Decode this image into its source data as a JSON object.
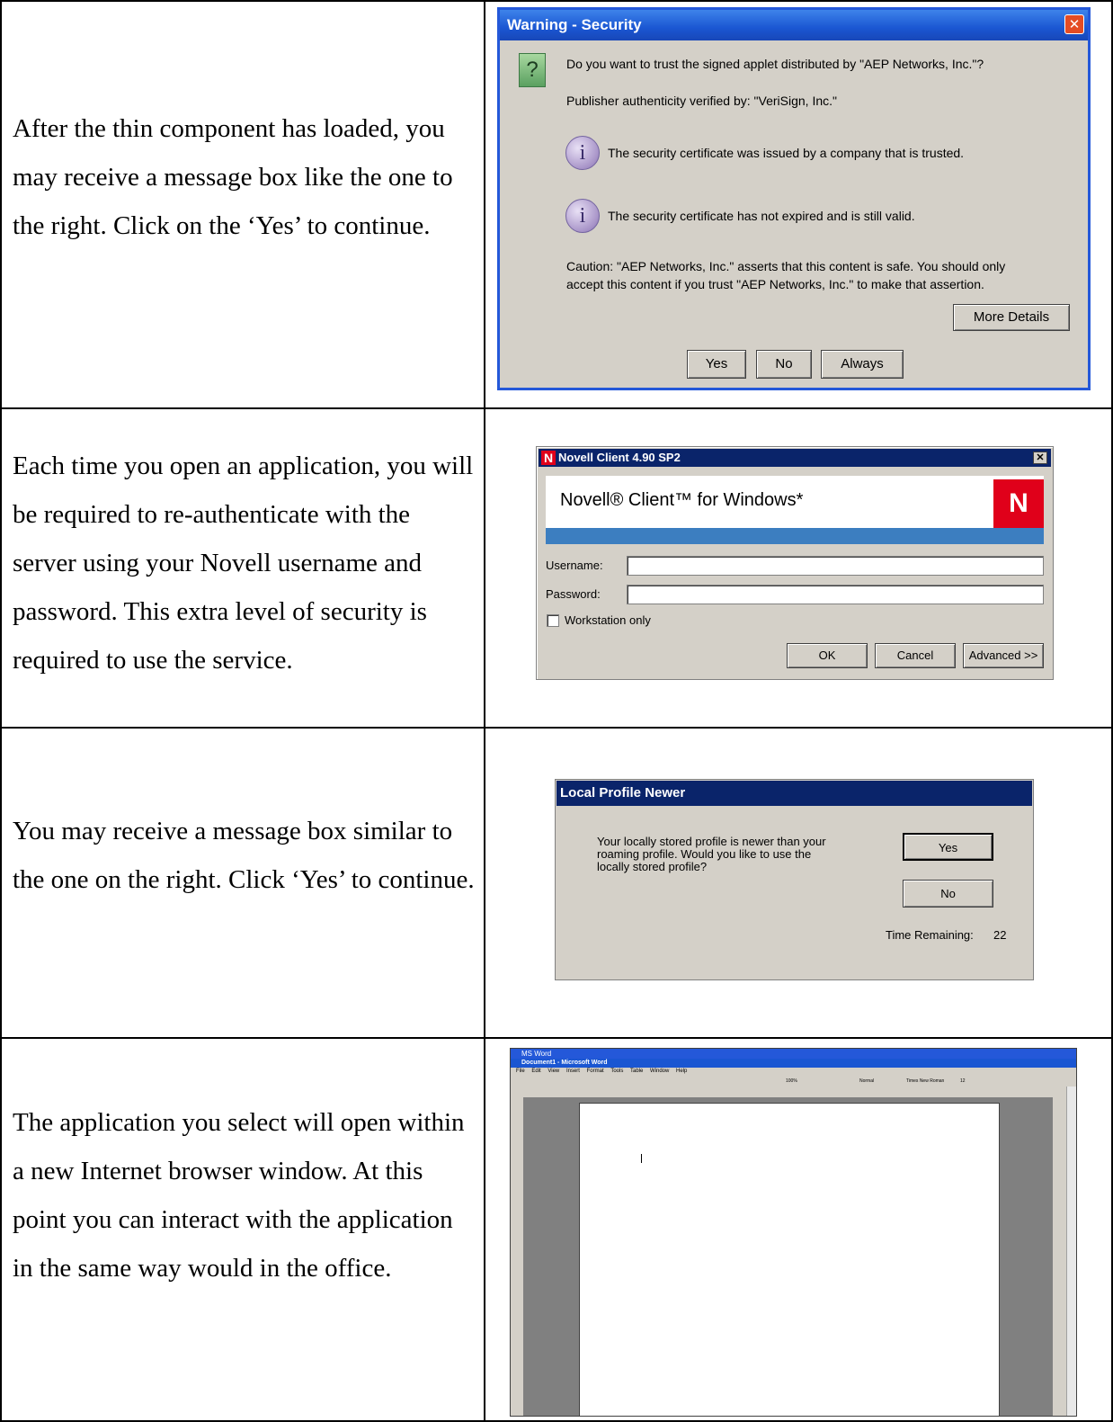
{
  "rows": [
    {
      "text": "After the thin component has loaded, you may receive a message box like the one to the right. Click on the ‘Yes’ to continue."
    },
    {
      "text": "Each time you open an application, you will be required to re-authenticate with the server using your Novell username and password. This extra level of security is required to use the service."
    },
    {
      "text": "You may receive a message box similar to the one on the right. Click ‘Yes’ to continue."
    },
    {
      "text": "The application you select will open within a new Internet browser window. At this point you can interact with the application in the same way would in the office."
    }
  ],
  "security_dialog": {
    "title": "Warning - Security",
    "question": "Do you want to trust the signed applet distributed by \"AEP Networks, Inc.\"?",
    "publisher": "Publisher authenticity verified by: \"VeriSign, Inc.\"",
    "info1": "The security certificate was issued by a company that is trusted.",
    "info2": "The security certificate has not expired and is still valid.",
    "caution1": "Caution: \"AEP Networks, Inc.\" asserts that this content is safe. You should only",
    "caution2": "accept this content if you trust \"AEP Networks, Inc.\" to make that assertion.",
    "more_details": "More Details",
    "yes": "Yes",
    "no": "No",
    "always": "Always"
  },
  "novell_dialog": {
    "title": "Novell Client 4.90 SP2",
    "banner": "Novell® Client™ for Windows*",
    "logo_letter": "N",
    "username_label": "Username:",
    "password_label": "Password:",
    "workstation_label": "Workstation only",
    "ok": "OK",
    "cancel": "Cancel",
    "advanced": "Advanced >>"
  },
  "profile_dialog": {
    "title": "Local Profile Newer",
    "message1": "Your locally stored profile is newer than your",
    "message2": "roaming profile.  Would you like to use the",
    "message3": "locally stored profile?",
    "yes": "Yes",
    "no": "No",
    "time_label": "Time Remaining:",
    "time_value": "22"
  },
  "word_window": {
    "outer_title": "MS Word",
    "doc_title": "Document1 - Microsoft Word",
    "menu": [
      "File",
      "Edit",
      "View",
      "Insert",
      "Format",
      "Tools",
      "Table",
      "Window",
      "Help"
    ],
    "zoom": "100%",
    "style": "Normal",
    "font": "Times New Roman",
    "size": "12"
  }
}
